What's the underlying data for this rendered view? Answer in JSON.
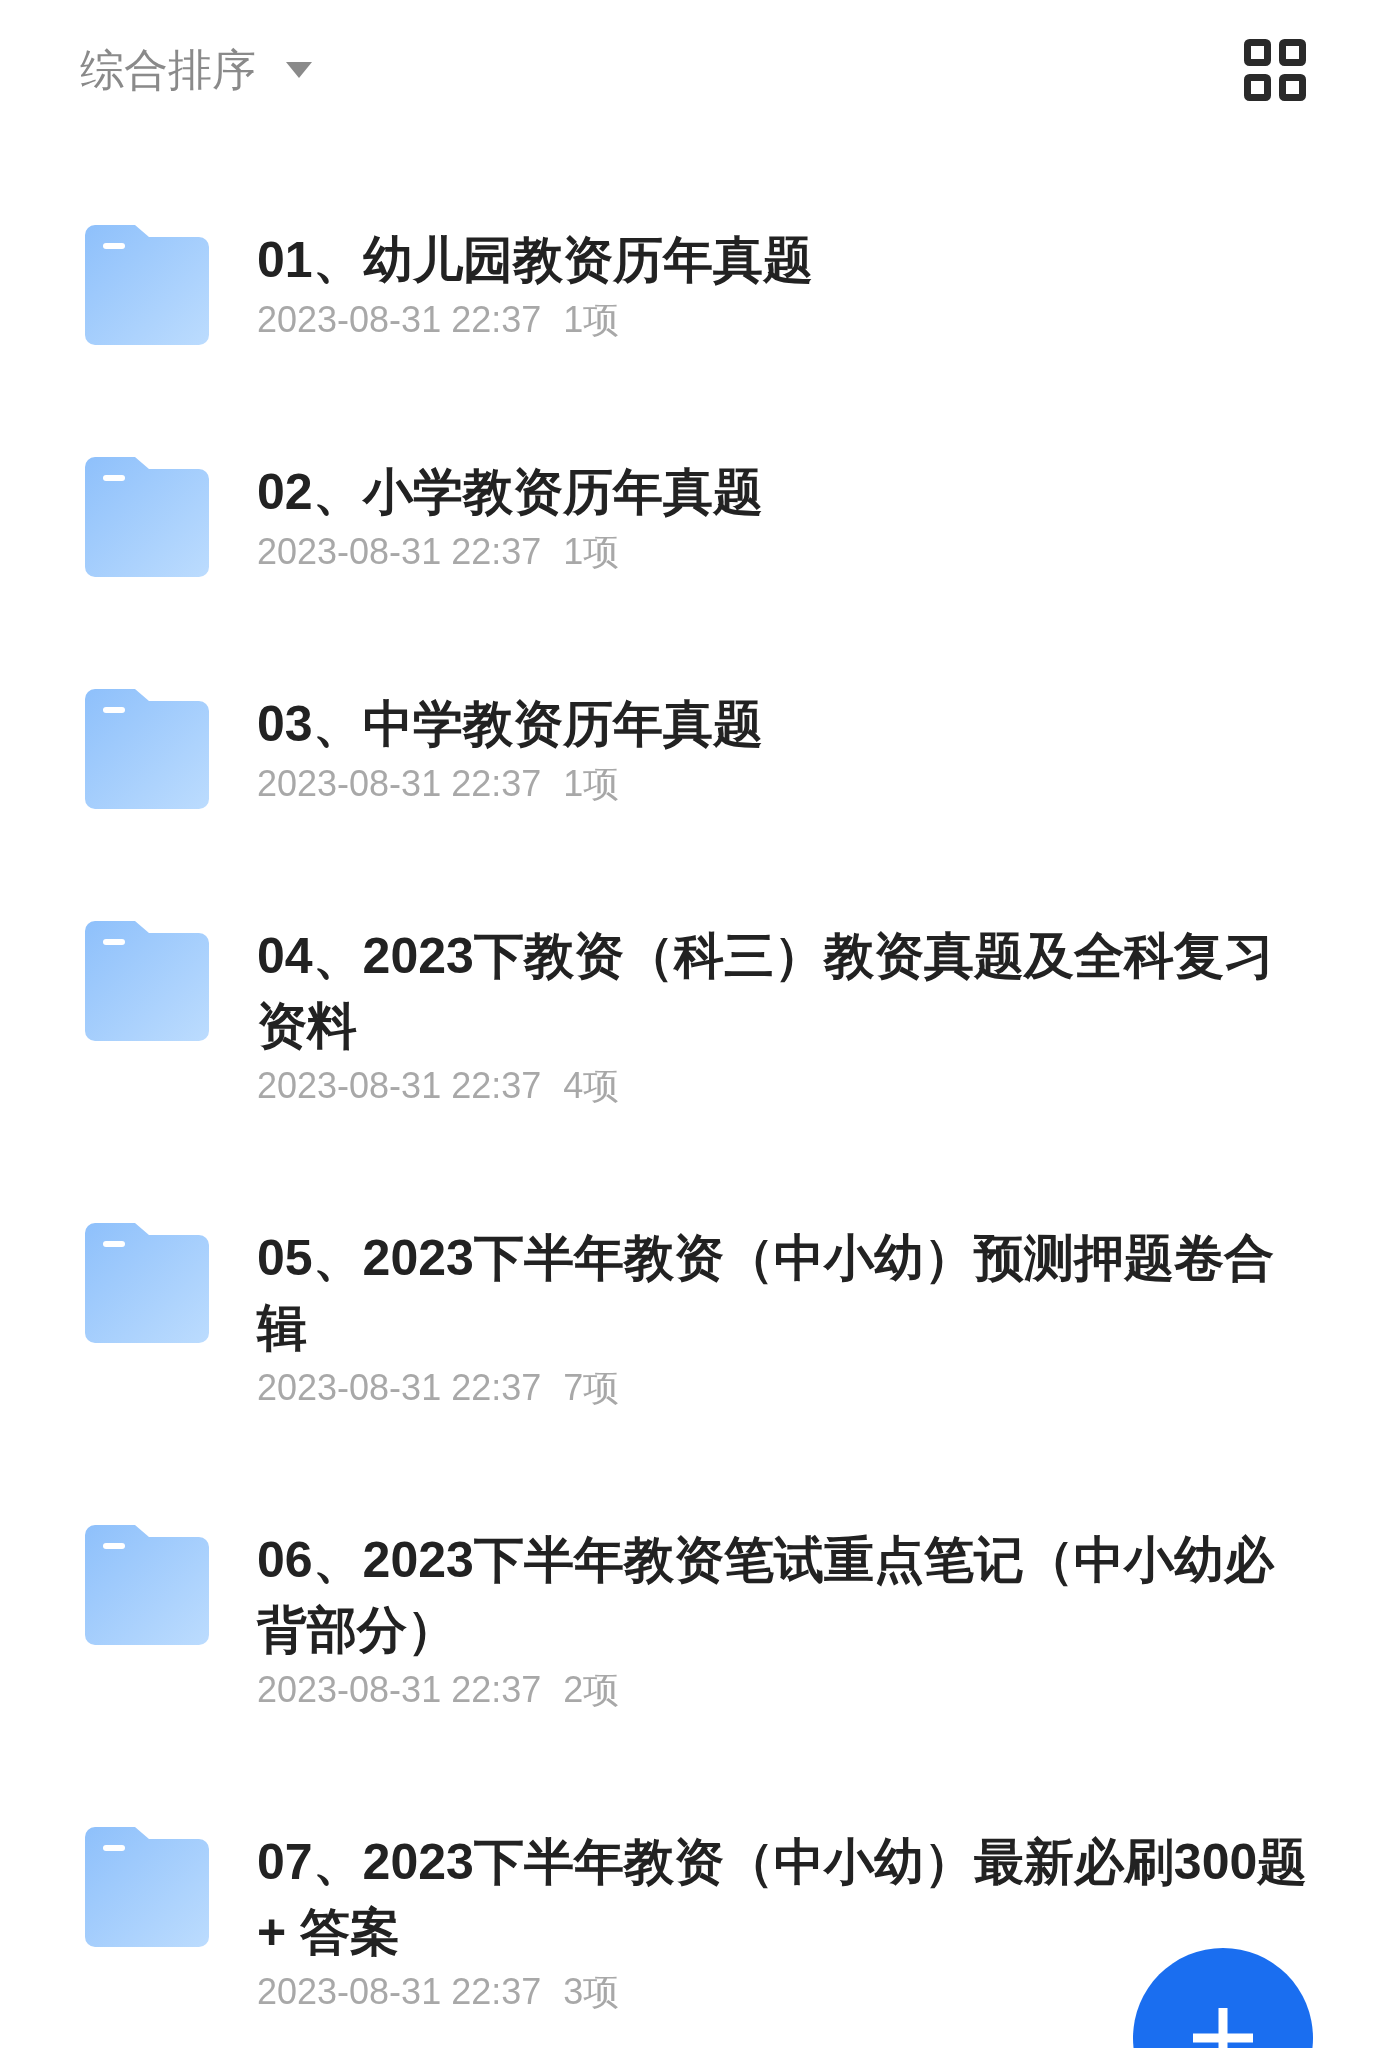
{
  "toolbar": {
    "sort_label": "综合排序"
  },
  "folders": [
    {
      "name": "01、幼儿园教资历年真题",
      "modified": "2023-08-31 22:37",
      "count": "1项"
    },
    {
      "name": "02、小学教资历年真题",
      "modified": "2023-08-31 22:37",
      "count": "1项"
    },
    {
      "name": "03、中学教资历年真题",
      "modified": "2023-08-31 22:37",
      "count": "1项"
    },
    {
      "name": "04、2023下教资（科三）教资真题及全科复习资料",
      "modified": "2023-08-31 22:37",
      "count": "4项"
    },
    {
      "name": "05、2023下半年教资（中小幼）预测押题卷合辑",
      "modified": "2023-08-31 22:37",
      "count": "7项"
    },
    {
      "name": "06、2023下半年教资笔试重点笔记（中小幼必背部分）",
      "modified": "2023-08-31 22:37",
      "count": "2项"
    },
    {
      "name": "07、2023下半年教资（中小幼）最新必刷300题 + 答案",
      "modified": "2023-08-31 22:37",
      "count": "3项"
    }
  ]
}
